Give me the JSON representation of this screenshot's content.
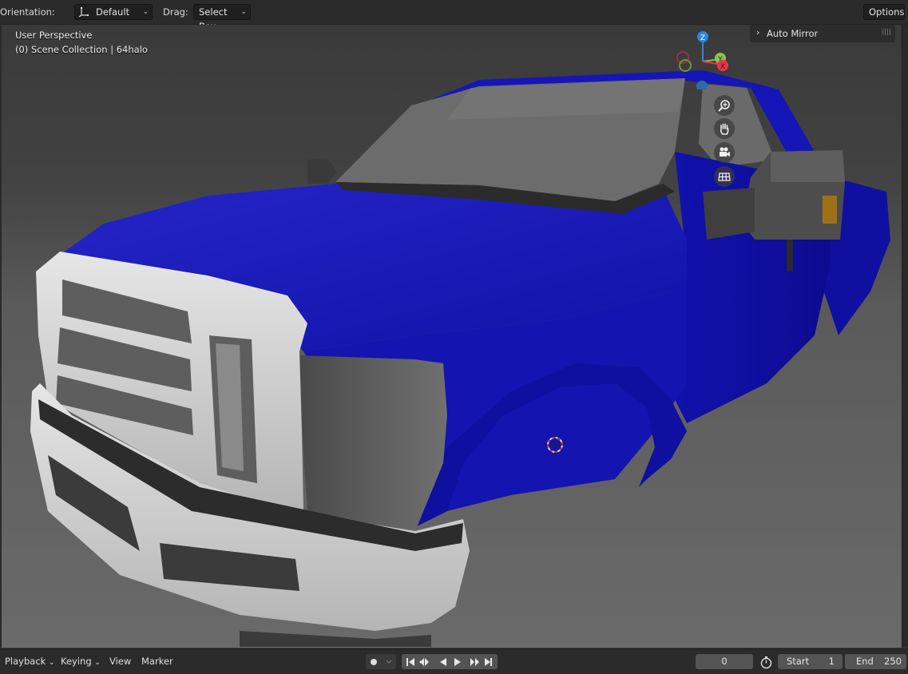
{
  "header": {
    "orientation_label": "Orientation:",
    "orientation_value": "Default",
    "drag_label": "Drag:",
    "drag_value": "Select Box",
    "options_label": "Options"
  },
  "viewport": {
    "perspective": "User Perspective",
    "collection": "(0) Scene Collection | 64halo",
    "panel_title": "Auto Mirror",
    "gizmo": {
      "z": "Z",
      "y": "Y",
      "x": "X"
    },
    "nav_icons": [
      "zoom-icon",
      "hand-pan-icon",
      "camera-icon",
      "grid-view-icon"
    ]
  },
  "timeline": {
    "playback_label": "Playback",
    "keying_label": "Keying",
    "view_label": "View",
    "marker_label": "Marker",
    "current_frame": "0",
    "start_label": "Start",
    "start_value": "1",
    "end_label": "End",
    "end_value": "250"
  },
  "colors": {
    "truck_body": "#1414b4",
    "grille": "#d9d9d9",
    "viewport_bg": "#3d3d3d",
    "gizmo_x": "#e8344e",
    "gizmo_y": "#8bc34a",
    "gizmo_z": "#2f86dd"
  }
}
